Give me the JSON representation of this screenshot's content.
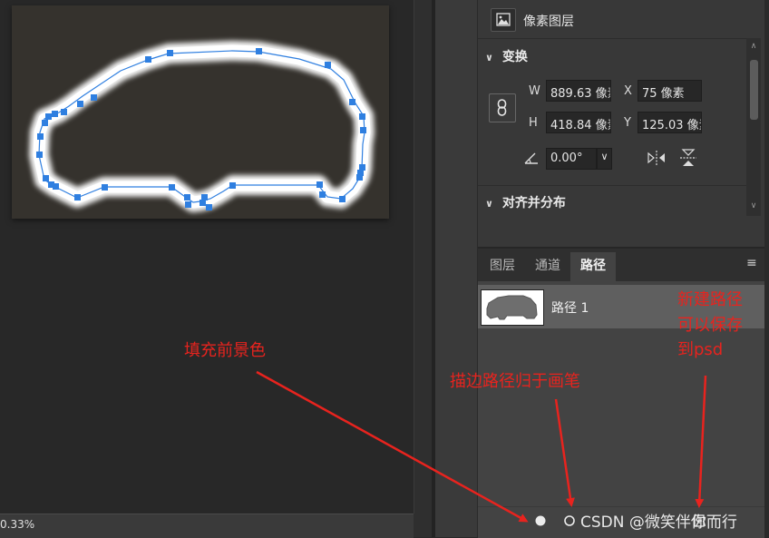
{
  "properties": {
    "title": "像素图层",
    "transform_section": "变换",
    "align_section": "对齐并分布",
    "w_label": "W",
    "w_value": "889.63 像素",
    "h_label": "H",
    "h_value": "418.84 像素",
    "x_label": "X",
    "x_value": "75 像素",
    "y_label": "Y",
    "y_value": "125.03 像素",
    "angle_value": "0.00°"
  },
  "layers_panel": {
    "tabs": [
      {
        "label": "图层",
        "active": false
      },
      {
        "label": "通道",
        "active": false
      },
      {
        "label": "路径",
        "active": true
      }
    ],
    "path_item": "路径 1"
  },
  "status_bar": {
    "zoom": "0.33%"
  },
  "annotations": {
    "fill_note": "填充前景色",
    "stroke_note": "描边路径归于画笔",
    "new_path_note_line1": "新建路径",
    "new_path_note_line2": "可以保存",
    "new_path_note_line3": "到psd"
  },
  "watermark": "CSDN @微笑伴你而行",
  "icons": {
    "fill-path": "filled-circle-icon",
    "stroke-path": "hollow-circle-icon",
    "panel-menu": "hamburger-menu-icon",
    "link": "chain-link-icon",
    "flip-h": "flip-horizontal-icon",
    "flip-v": "flip-vertical-icon",
    "angle": "angle-icon"
  },
  "colors": {
    "annotation": "#e8231e",
    "anchor": "#2f7fe0",
    "panel_bg": "#383838",
    "canvas_bg": "#282828"
  }
}
